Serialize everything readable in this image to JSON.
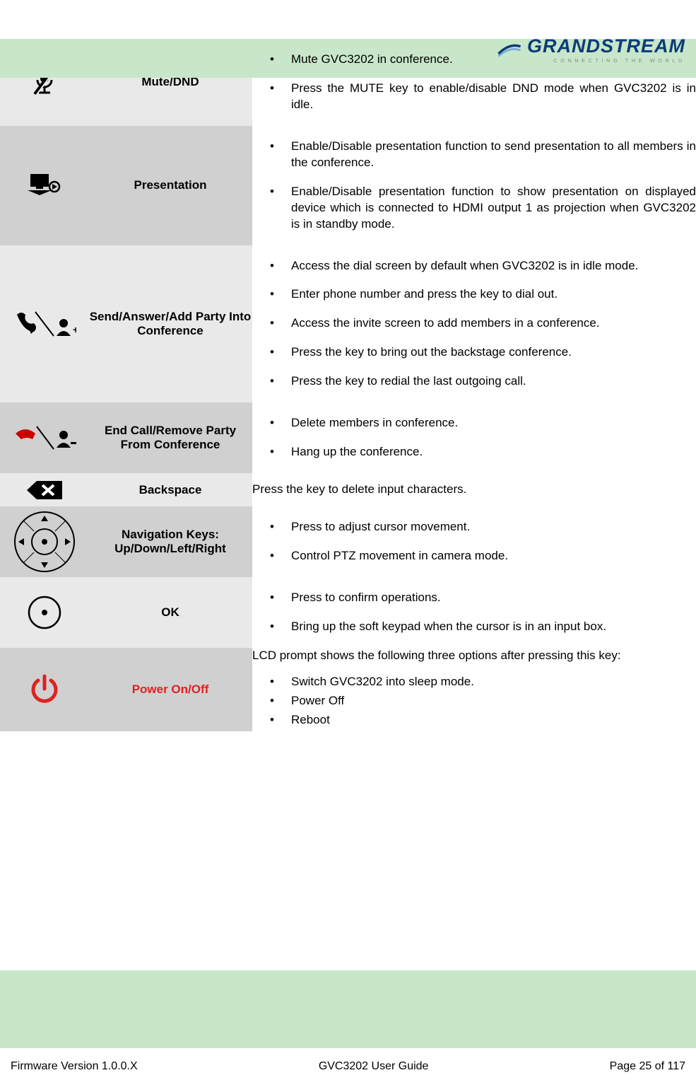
{
  "brand": {
    "name": "GRANDSTREAM",
    "tagline": "CONNECTING THE WORLD"
  },
  "rows": [
    {
      "name": "Mute/DND",
      "items": [
        "Mute GVC3202 in conference.",
        "Press the MUTE key to enable/disable DND mode when GVC3202 is in idle."
      ]
    },
    {
      "name": "Presentation",
      "items": [
        "Enable/Disable presentation function to send presentation to all members in the conference.",
        "Enable/Disable presentation function to show presentation on displayed device which is connected to HDMI output 1 as projection when GVC3202 is in standby mode."
      ]
    },
    {
      "name": "Send/Answer/Add Party Into Conference",
      "items": [
        "Access the dial screen by default when GVC3202 is in idle mode.",
        "Enter phone number and press the key to dial out.",
        "Access the invite screen to add members in a conference.",
        "Press the key to bring out the backstage conference.",
        "Press the key to redial the last outgoing call."
      ]
    },
    {
      "name": "End Call/Remove Party From Conference",
      "items": [
        "Delete members in conference.",
        "Hang up the conference."
      ]
    },
    {
      "name": "Backspace",
      "desc": "Press the key to delete input characters."
    },
    {
      "name": "Navigation Keys: Up/Down/Left/Right",
      "items": [
        "Press to adjust cursor movement.",
        "Control PTZ movement in camera mode."
      ]
    },
    {
      "name": "OK",
      "items": [
        "Press to confirm operations.",
        "Bring up the soft keypad when the cursor is in an input box."
      ]
    },
    {
      "name": "Power On/Off",
      "intro": "LCD prompt shows the following three options after pressing this key:",
      "items": [
        "Switch GVC3202 into sleep mode.",
        "Power Off",
        "Reboot"
      ]
    }
  ],
  "footer": {
    "left": "Firmware Version 1.0.0.X",
    "center": "GVC3202 User Guide",
    "right": "Page 25 of 117"
  }
}
